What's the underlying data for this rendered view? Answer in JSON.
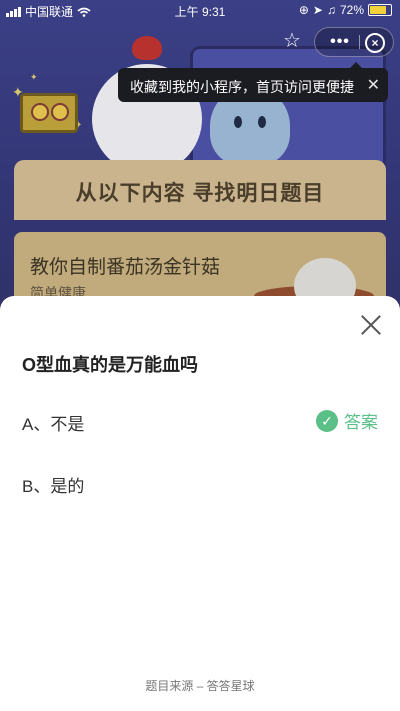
{
  "status_bar": {
    "carrier": "中国联通",
    "time": "上午 9:31",
    "battery": "72%"
  },
  "mini_program": {
    "tooltip": "收藏到我的小程序，首页访问更便捷"
  },
  "background": {
    "find_title": "从以下内容 寻找明日题目",
    "card_title": "教你自制番茄汤金针菇",
    "card_subtitle": "简单健康"
  },
  "quiz": {
    "question": "O型血真的是万能血吗",
    "options": [
      {
        "label": "A、不是",
        "is_answer": true
      },
      {
        "label": "B、是的",
        "is_answer": false
      }
    ],
    "answer_label": "答案",
    "footer": "题目来源 – 答答星球"
  },
  "colors": {
    "accent_green": "#5bbf88",
    "sheet_bg": "#ffffff"
  },
  "icons": [
    "wifi-icon",
    "signal-icon",
    "star-icon",
    "more-icon",
    "close-circle-icon",
    "close-icon",
    "check-icon"
  ]
}
